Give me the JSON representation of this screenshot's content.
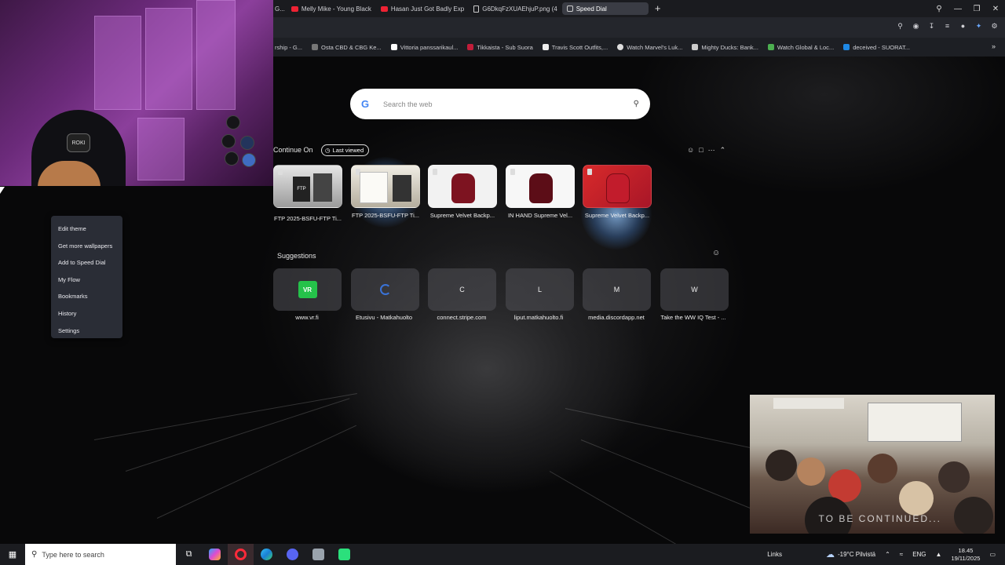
{
  "browser": {
    "tabs": [
      {
        "label": "G...",
        "icon": "youtube-icon"
      },
      {
        "label": "Melly Mike - Young Black",
        "icon": "youtube-icon"
      },
      {
        "label": "Hasan Just Got Badly Exp",
        "icon": "youtube-icon"
      },
      {
        "label": "G6DkqFzXUAEhjuP.png (4",
        "icon": "document-icon"
      },
      {
        "label": "Speed Dial",
        "icon": "grid-icon",
        "active": true
      }
    ],
    "bookmarks": [
      {
        "label": "rship - G..."
      },
      {
        "label": "Osta CBD & CBG Ke..."
      },
      {
        "label": "Vittoria panssarikaul..."
      },
      {
        "label": "Tikkaista - Sub Suora"
      },
      {
        "label": "Travis Scott Outfits,..."
      },
      {
        "label": "Watch Marvel's Luk..."
      },
      {
        "label": "Mighty Ducks: Bank..."
      },
      {
        "label": "Watch Global & Loc..."
      },
      {
        "label": "deceived - SUORAT..."
      }
    ]
  },
  "search": {
    "placeholder": "Search the web",
    "logo": "G"
  },
  "continue_on": {
    "title": "Continue On",
    "pill": "Last viewed",
    "items": [
      {
        "label": "FTP 2025-BSFU-FTP Ti..."
      },
      {
        "label": "FTP 2025-BSFU-FTP Ti..."
      },
      {
        "label": "Supreme Velvet Backp..."
      },
      {
        "label": "IN HAND Supreme Vel..."
      },
      {
        "label": "Supreme Velvet Backp..."
      }
    ],
    "thumb_text": "FTP"
  },
  "suggestions": {
    "title": "Suggestions",
    "items": [
      {
        "letter": "VR",
        "label": "www.vr.fi"
      },
      {
        "letter": "",
        "label": "Etusivu - Matkahuolto"
      },
      {
        "letter": "C",
        "label": "connect.stripe.com"
      },
      {
        "letter": "L",
        "label": "liput.matkahuolto.fi"
      },
      {
        "letter": "M",
        "label": "media.discordapp.net"
      },
      {
        "letter": "W",
        "label": "Take the WW IQ Test - ..."
      }
    ]
  },
  "context_menu": {
    "items": [
      "Edit theme",
      "Get more wallpapers",
      "Add to Speed Dial",
      "My Flow",
      "Bookmarks",
      "History",
      "Settings"
    ]
  },
  "webcam": {
    "cap_text": "ROKI"
  },
  "clip": {
    "overlay_text": "TO BE CONTINUED..."
  },
  "taskbar": {
    "search_placeholder": "Type here to search",
    "links_label": "Links",
    "weather": "-19°C Pilvistä",
    "language": "ENG",
    "time": "18.45",
    "date": "19/11/2025"
  },
  "colors": {
    "accent": "#4285f4",
    "vr_green": "#25c24a",
    "menu_bg": "#2a2d36"
  }
}
